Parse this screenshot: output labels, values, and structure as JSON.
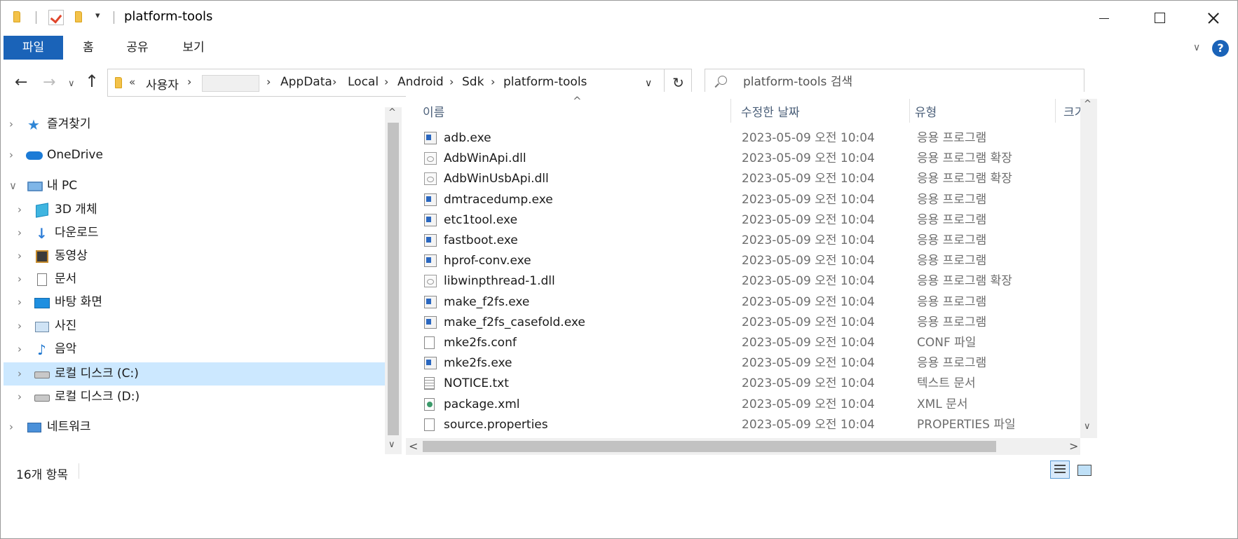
{
  "window": {
    "title": "platform-tools",
    "quick_access": {
      "dropdown": "▾"
    }
  },
  "ribbon": {
    "tabs": [
      {
        "label": "파일",
        "active": true
      },
      {
        "label": "홈"
      },
      {
        "label": "공유"
      },
      {
        "label": "보기"
      }
    ],
    "expand": "∨",
    "help": "?"
  },
  "navigation": {
    "back": "←",
    "forward": "→",
    "recent": "∨",
    "up": "↑",
    "address": {
      "more": "«",
      "crumbs": [
        "사용자",
        "",
        "AppData",
        "Local",
        "Android",
        "Sdk",
        "platform-tools"
      ],
      "separator": "›",
      "dropdown": "∨"
    },
    "refresh": "↻",
    "search": {
      "placeholder": "platform-tools 검색"
    }
  },
  "nav_pane": {
    "items": [
      {
        "label": "즐겨찾기",
        "icon": "star-icon",
        "chevron": "›"
      },
      {
        "label": "OneDrive",
        "icon": "cloud-icon",
        "chevron": "›"
      },
      {
        "label": "내 PC",
        "icon": "pc-icon",
        "chevron": "∨"
      },
      {
        "label": "3D 개체",
        "icon": "3d-objects-icon",
        "chevron": "›"
      },
      {
        "label": "다운로드",
        "icon": "download-icon",
        "chevron": "›"
      },
      {
        "label": "동영상",
        "icon": "video-icon",
        "chevron": "›"
      },
      {
        "label": "문서",
        "icon": "document-icon",
        "chevron": "›"
      },
      {
        "label": "바탕 화면",
        "icon": "desktop-icon",
        "chevron": "›"
      },
      {
        "label": "사진",
        "icon": "pictures-icon",
        "chevron": "›"
      },
      {
        "label": "음악",
        "icon": "music-icon",
        "chevron": "›"
      },
      {
        "label": "로컬 디스크 (C:)",
        "icon": "drive-c-icon",
        "chevron": "›",
        "selected": true
      },
      {
        "label": "로컬 디스크 (D:)",
        "icon": "drive-d-icon",
        "chevron": "›"
      },
      {
        "label": "네트워크",
        "icon": "network-icon",
        "chevron": "›"
      }
    ],
    "scroll": {
      "up": "^",
      "down": "∨"
    }
  },
  "file_list": {
    "sort_indicator": "^",
    "columns": {
      "name": "이름",
      "date": "수정한 날짜",
      "type": "유형",
      "size": "크기"
    },
    "files": [
      {
        "name": "adb.exe",
        "date": "2023-05-09 오전 10:04",
        "type": "응용 프로그램",
        "icon": "exe-icon"
      },
      {
        "name": "AdbWinApi.dll",
        "date": "2023-05-09 오전 10:04",
        "type": "응용 프로그램 확장",
        "icon": "dll-icon"
      },
      {
        "name": "AdbWinUsbApi.dll",
        "date": "2023-05-09 오전 10:04",
        "type": "응용 프로그램 확장",
        "icon": "dll-icon"
      },
      {
        "name": "dmtracedump.exe",
        "date": "2023-05-09 오전 10:04",
        "type": "응용 프로그램",
        "icon": "exe-icon"
      },
      {
        "name": "etc1tool.exe",
        "date": "2023-05-09 오전 10:04",
        "type": "응용 프로그램",
        "icon": "exe-icon"
      },
      {
        "name": "fastboot.exe",
        "date": "2023-05-09 오전 10:04",
        "type": "응용 프로그램",
        "icon": "exe-icon"
      },
      {
        "name": "hprof-conv.exe",
        "date": "2023-05-09 오전 10:04",
        "type": "응용 프로그램",
        "icon": "exe-icon"
      },
      {
        "name": "libwinpthread-1.dll",
        "date": "2023-05-09 오전 10:04",
        "type": "응용 프로그램 확장",
        "icon": "dll-icon"
      },
      {
        "name": "make_f2fs.exe",
        "date": "2023-05-09 오전 10:04",
        "type": "응용 프로그램",
        "icon": "exe-icon"
      },
      {
        "name": "make_f2fs_casefold.exe",
        "date": "2023-05-09 오전 10:04",
        "type": "응용 프로그램",
        "icon": "exe-icon"
      },
      {
        "name": "mke2fs.conf",
        "date": "2023-05-09 오전 10:04",
        "type": "CONF 파일",
        "icon": "file-icon"
      },
      {
        "name": "mke2fs.exe",
        "date": "2023-05-09 오전 10:04",
        "type": "응용 프로그램",
        "icon": "exe-icon"
      },
      {
        "name": "NOTICE.txt",
        "date": "2023-05-09 오전 10:04",
        "type": "텍스트 문서",
        "icon": "text-file-icon"
      },
      {
        "name": "package.xml",
        "date": "2023-05-09 오전 10:04",
        "type": "XML 문서",
        "icon": "xml-file-icon"
      },
      {
        "name": "source.properties",
        "date": "2023-05-09 오전 10:04",
        "type": "PROPERTIES 파일",
        "icon": "file-icon"
      }
    ],
    "scroll": {
      "up": "^",
      "down": "∨",
      "left": "<",
      "right": ">"
    }
  },
  "status": {
    "item_count": "16개 항목"
  },
  "colors": {
    "accent": "#1a63b8",
    "selection": "#cce8ff",
    "header_text": "#4c607a",
    "secondary_text": "#6d6d6d"
  }
}
